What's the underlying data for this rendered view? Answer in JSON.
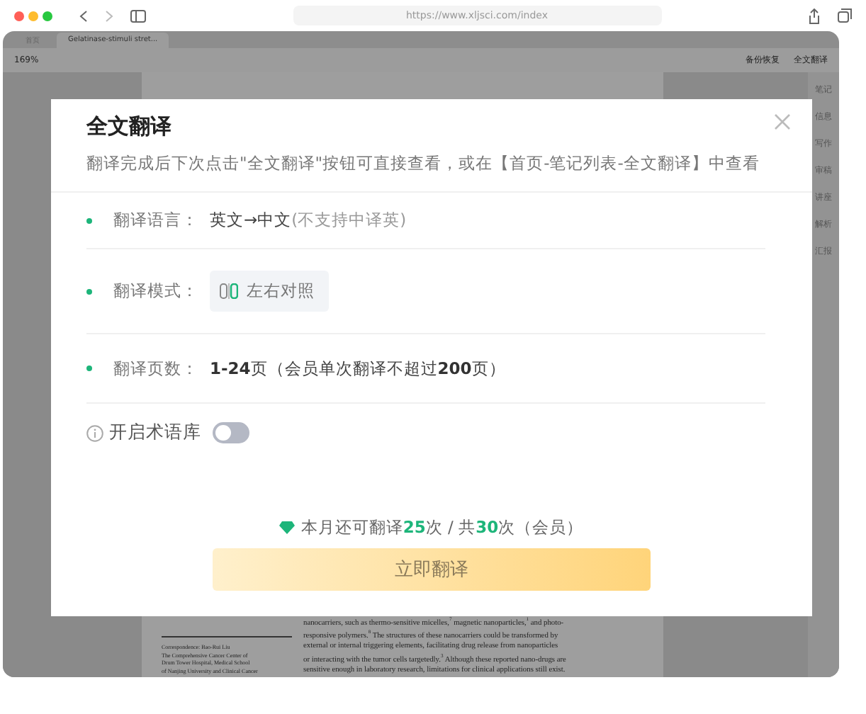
{
  "browser": {
    "url": "https://www.xljsci.com/index"
  },
  "tabs": [
    {
      "label": "首页",
      "selected": false
    },
    {
      "label": "Gelatinase-stimuli stret...",
      "selected": true
    }
  ],
  "toolbar": {
    "zoom": "169%",
    "backup": "备份恢复",
    "translate": "全文翻译"
  },
  "side_panel": {
    "items": [
      "笔记",
      "信息",
      "写作",
      "审稿",
      "讲座",
      "解析",
      "汇报"
    ]
  },
  "paper": {
    "correspondence": [
      "Correspondence: Bao-Rui Liu",
      "The Comprehensive Cancer Center of",
      "Drum Tower Hospital, Medical School",
      "of Nanjing University and Clinical Cancer"
    ],
    "body": [
      "nanocarriers, such as thermo-sensitive micelles,$^{7}$ magnetic nanoparticles,$^{1}$ and photo-",
      "responsive polymers.$^{8}$ The structures of these nanocarriers could be transformed by",
      "external or internal triggering elements, facilitating drug release from nanoparticles",
      "or interacting with the tumor cells targetedly.$^{3}$ Although these reported nano-drugs are",
      "sensitive enough in laboratory research, limitations for clinical applications still exist."
    ]
  },
  "dialog": {
    "title": "全文翻译",
    "subtitle": "翻译完成后下次点击\"全文翻译\"按钮可直接查看，或在【首页-笔记列表-全文翻译】中查看",
    "rows": [
      {
        "kind": "language",
        "label": "翻译语言：",
        "value": "英文→中文",
        "note": "(不支持中译英)"
      },
      {
        "kind": "mode",
        "label": "翻译模式：",
        "value": "左右对照"
      },
      {
        "kind": "pages",
        "label": "翻译页数：",
        "value": "**1-24**页（会员单次翻译不超过**200**页）"
      }
    ],
    "term_library": {
      "label": "开启术语库",
      "on": false
    },
    "quota": "本月还可翻译**25**次 / 共**30**次（会员）",
    "button": "立即翻译"
  }
}
